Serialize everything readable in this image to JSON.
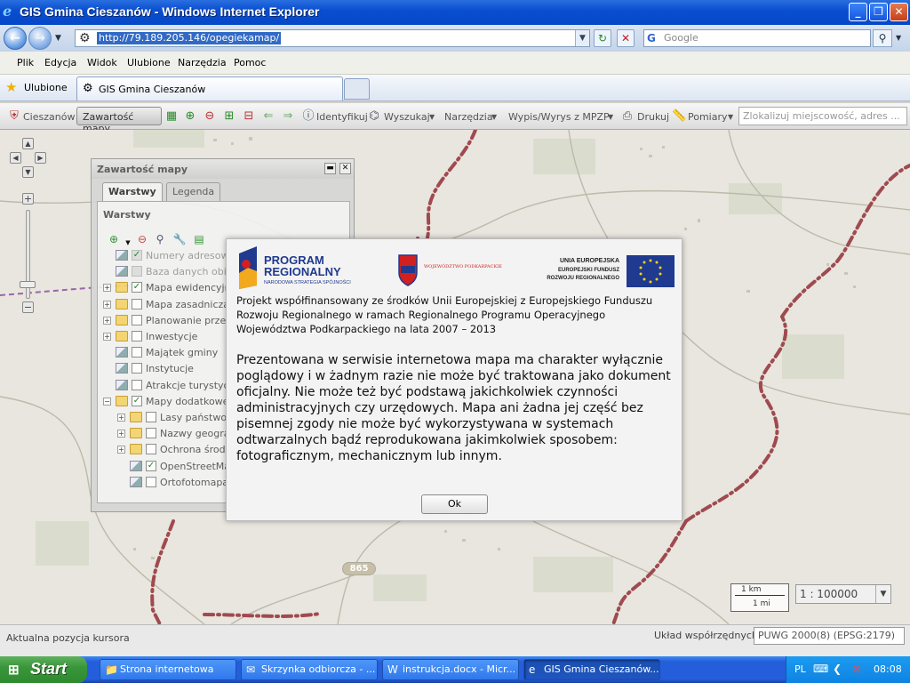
{
  "window": {
    "title": "GIS Gmina Cieszanów - Windows Internet Explorer"
  },
  "address": {
    "url": "http://79.189.205.146/opegiekamap/",
    "search_placeholder": "Google"
  },
  "menu": [
    "Plik",
    "Edycja",
    "Widok",
    "Ulubione",
    "Narzędzia",
    "Pomoc"
  ],
  "favorites": {
    "label": "Ulubione",
    "tab_title": "GIS Gmina Cieszanów"
  },
  "toolbar": {
    "home": "Cieszanów",
    "content_map": "Zawartość mapy",
    "identify": "Identyfikuj",
    "search": "Wyszukaj",
    "tools": "Narzędzia",
    "extract": "Wypis/Wyrys z MPZP",
    "print": "Drukuj",
    "measure": "Pomiary",
    "locate_placeholder": "Zlokalizuj miejscowość, adres ..."
  },
  "layer_panel": {
    "title": "Zawartość mapy",
    "tabs": [
      "Warstwy",
      "Legenda"
    ],
    "section": "Warstwy",
    "items": [
      {
        "label": "Numery adresowe",
        "checked": true,
        "dim": true
      },
      {
        "label": "Baza danych obiek",
        "checked": false,
        "dim": true
      },
      {
        "label": "Mapa ewidencyjna",
        "checked": true,
        "dim": false
      },
      {
        "label": "Mapa zasadnicza",
        "checked": false,
        "dim": false
      },
      {
        "label": "Planowanie przestr",
        "checked": false,
        "dim": false
      },
      {
        "label": "Inwestycje",
        "checked": false,
        "dim": false
      },
      {
        "label": "Majątek gminy",
        "checked": false,
        "dim": false
      },
      {
        "label": "Instytucje",
        "checked": false,
        "dim": false
      },
      {
        "label": "Atrakcje turystyczn",
        "checked": false,
        "dim": false
      },
      {
        "label": "Mapy dodatkowe (s",
        "checked": true,
        "dim": false
      },
      {
        "label": "Lasy państwow",
        "checked": false,
        "dim": false
      },
      {
        "label": "Nazwy geograf",
        "checked": false,
        "dim": false
      },
      {
        "label": "Ochrona środow",
        "checked": false,
        "dim": false
      },
      {
        "label": "OpenStreetMap",
        "checked": true,
        "dim": false
      },
      {
        "label": "Ortofotomapa (C",
        "checked": false,
        "dim": false
      }
    ]
  },
  "modal": {
    "logo_program": "PROGRAM",
    "logo_regionalny": "REGIONALNY",
    "logo_nss": "NARODOWA STRATEGIA SPÓJNOŚCI",
    "logo_woj": "WOJEWÓDZTWO PODKARPACKIE",
    "logo_ue1": "UNIA EUROPEJSKA",
    "logo_ue2": "EUROPEJSKI FUNDUSZ",
    "logo_ue3": "ROZWOJU REGIONALNEGO",
    "funding": "Projekt współfinansowany ze środków Unii Europejskiej z Europejskiego Funduszu Rozwoju Regionalnego w ramach Regionalnego Programu Operacyjnego Województwa Podkarpackiego na lata 2007 – 2013",
    "disclaimer": "Prezentowana w serwisie internetowa mapa ma charakter wyłącznie poglądowy i w żadnym razie nie może być traktowana jako dokument oficjalny. Nie może też być podstawą jakichkolwiek czynności administracyjnych czy urzędowych. Mapa ani żadna jej część bez pisemnej zgody nie może być wykorzystywana w systemach odtwarzalnych bądź reprodukowana jakimkolwiek sposobem: fotograficznym, mechanicznym lub innym.",
    "ok": "Ok"
  },
  "map": {
    "road_label": "865",
    "scale_km": "1 km",
    "scale_mi": "1 mi",
    "scale_value": "1 : 100000"
  },
  "status": {
    "cursor": "Aktualna pozycja kursora",
    "crs_label": "Układ współrzędnych:",
    "crs_value": "PUWG 2000(8) (EPSG:2179)"
  },
  "taskbar": {
    "start": "Start",
    "tasks": [
      "Strona internetowa",
      "Skrzynka odbiorcza - ...",
      "instrukcja.docx - Micr...",
      "GIS Gmina Cieszanów..."
    ],
    "lang": "PL",
    "clock": "08:08"
  },
  "colors": {
    "boundary": "#a04a50",
    "accent": "#316ac5",
    "map_bg": "#e8e6de"
  }
}
